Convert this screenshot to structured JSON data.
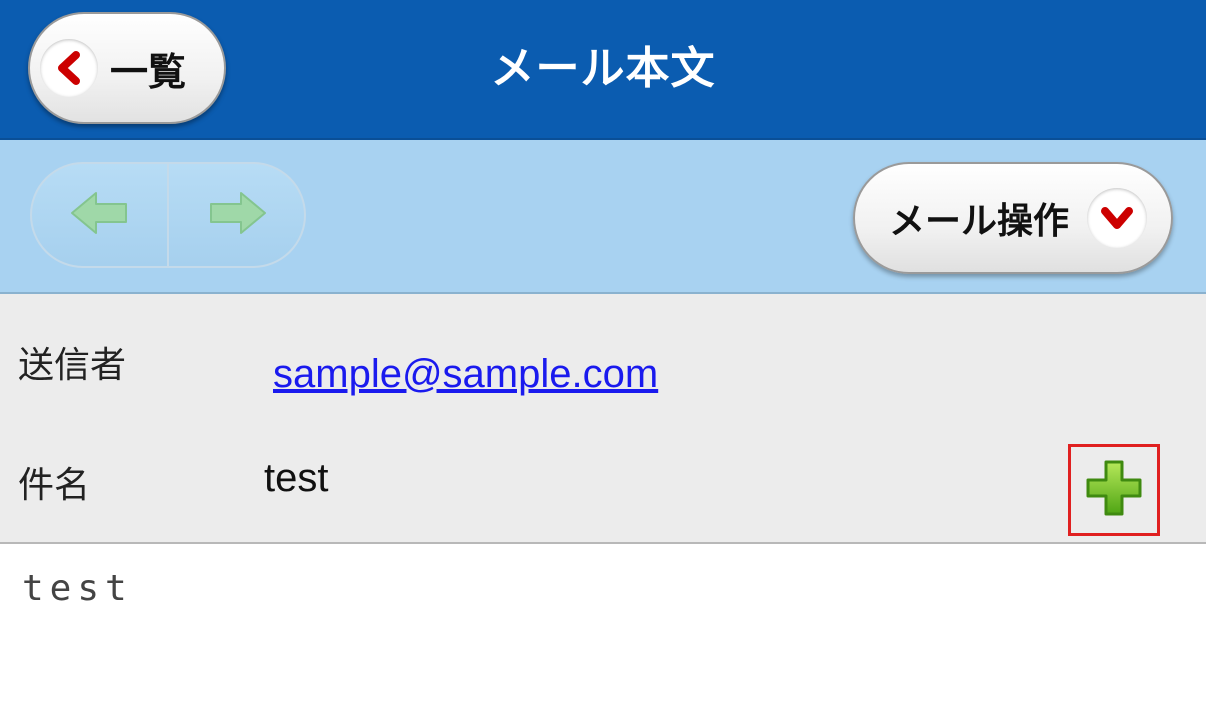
{
  "header": {
    "back_label": "一覧",
    "title": "メール本文"
  },
  "toolbar": {
    "prev_icon": "arrow-left-icon",
    "next_icon": "arrow-right-icon",
    "operations_label": "メール操作",
    "operations_icon": "chevron-down-icon"
  },
  "info": {
    "sender_label": "送信者",
    "sender_value": "sample@sample.com",
    "subject_label": "件名",
    "subject_value": "test",
    "add_icon": "plus-icon"
  },
  "mail": {
    "body": "test"
  },
  "colors": {
    "header_bg": "#0b5cb0",
    "toolbar_bg": "#a8d2f1",
    "info_bg": "#ececec",
    "link": "#1a1aee",
    "highlight_border": "#e02020",
    "chevron": "#cc0000",
    "plus": "#6abf1e"
  }
}
